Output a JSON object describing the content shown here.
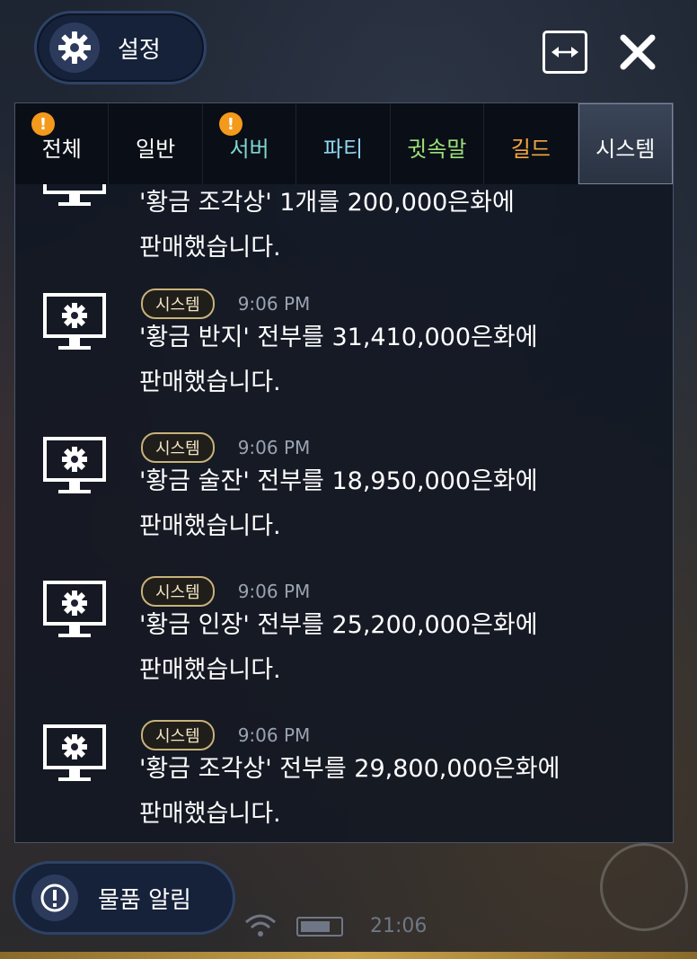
{
  "header": {
    "settings_label": "설정"
  },
  "tabs": [
    {
      "label": "전체",
      "color": "#ffffff",
      "badge": true
    },
    {
      "label": "일반",
      "color": "#ffffff",
      "badge": false
    },
    {
      "label": "서버",
      "color": "#7fd6d0",
      "badge": true
    },
    {
      "label": "파티",
      "color": "#8fd8f0",
      "badge": false
    },
    {
      "label": "귓속말",
      "color": "#9be07a",
      "badge": false
    },
    {
      "label": "길드",
      "color": "#f3a640",
      "badge": false
    },
    {
      "label": "시스템",
      "color": "#ffffff",
      "badge": false,
      "active": true
    }
  ],
  "badge_symbol": "!",
  "messages": [
    {
      "tag": "",
      "time": "",
      "line1": "'황금 조각상' 1개를 200,000은화에",
      "line2": "판매했습니다.",
      "partial": true
    },
    {
      "tag": "시스템",
      "time": "9:06 PM",
      "line1": "'황금 반지' 전부를 31,410,000은화에",
      "line2": "판매했습니다."
    },
    {
      "tag": "시스템",
      "time": "9:06 PM",
      "line1": "'황금 술잔' 전부를 18,950,000은화에",
      "line2": "판매했습니다."
    },
    {
      "tag": "시스템",
      "time": "9:06 PM",
      "line1": "'황금 인장' 전부를 25,200,000은화에",
      "line2": "판매했습니다."
    },
    {
      "tag": "시스템",
      "time": "9:06 PM",
      "line1": "'황금 조각상' 전부를 29,800,000은화에",
      "line2": "판매했습니다."
    }
  ],
  "footer": {
    "notice_label": "물품 알림",
    "clock": "21:06"
  },
  "icons": {
    "settings": "gear-icon",
    "expand": "expand-arrows-icon",
    "close": "close-icon",
    "message": "monitor-gear-icon",
    "notice": "exclamation-circle-icon"
  }
}
